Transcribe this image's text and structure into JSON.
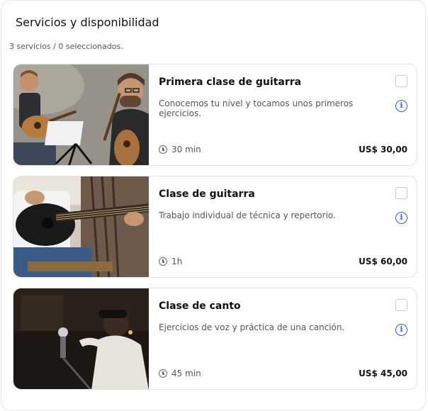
{
  "header": {
    "title": "Servicios y disponibilidad",
    "count": "3 servicios / 0 seleccionados."
  },
  "services": [
    {
      "name": "Primera clase de guitarra",
      "description": "Conocemos tu nivel y tocamos unos primeros ejercicios.",
      "duration": "30 min",
      "price": "US$ 30,00",
      "selected": false,
      "info_icon": "info-icon"
    },
    {
      "name": "Clase de guitarra",
      "description": "Trabajo individual de técnica y repertorio.",
      "duration": "1h",
      "price": "US$ 60,00",
      "selected": false,
      "info_icon": "info-icon"
    },
    {
      "name": "Clase de canto",
      "description": "Ejercicios de voz y práctica de una canción.",
      "duration": "45 min",
      "price": "US$ 45,00",
      "selected": false,
      "info_icon": "info-icon"
    }
  ],
  "colors": {
    "accent": "#2e63d6",
    "border": "#e3e3e3",
    "muted": "#555555"
  }
}
